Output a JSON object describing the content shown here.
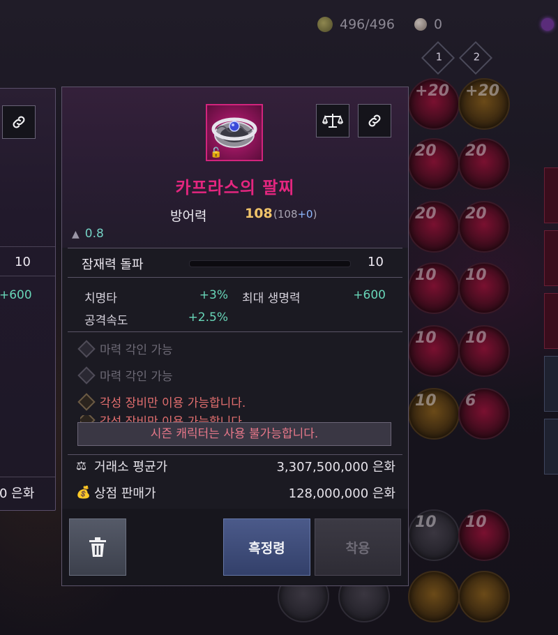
{
  "topbar": {
    "energy": "496/496",
    "pearls": "0",
    "presets": [
      "1",
      "2"
    ]
  },
  "left_tooltip": {
    "breakthrough_value": "10",
    "hp_value": "+600",
    "shop_price_partial": "0 은화"
  },
  "item": {
    "name": "카프라스의 팔찌",
    "defense_label": "방어력",
    "defense_value": "108",
    "defense_base_open": "(108",
    "defense_bonus": "+0",
    "defense_base_close": ")",
    "weight": "0.8",
    "locked": true,
    "rarity_color": "#d2247d"
  },
  "breakthrough": {
    "label": "잠재력 돌파",
    "value": "10"
  },
  "stats": [
    {
      "name": "치명타",
      "value": "+3%"
    },
    {
      "name": "최대 생명력",
      "value": "+600"
    },
    {
      "name": "공격속도",
      "value": "+2.5%"
    }
  ],
  "engravings": [
    {
      "text": "마력 각인 가능",
      "state": "disabled"
    },
    {
      "text": "마력 각인 가능",
      "state": "disabled"
    },
    {
      "text": "각성 장비만 이용 가능합니다.",
      "state": "warning"
    },
    {
      "text": "각성 장비만 이용 가능합니다.",
      "state": "warning-clipped"
    }
  ],
  "season_warning": "시즌 캐릭터는 사용 불가능합니다.",
  "prices": {
    "market_label": "거래소 평균가",
    "market_value": "3,307,500,000 은화",
    "shop_label": "상점 판매가",
    "shop_value": "128,000,000 은화"
  },
  "buttons": {
    "extract": "흑정령",
    "equip": "착용"
  },
  "slots": {
    "levels": [
      "+20",
      "+20",
      "20",
      "20",
      "20",
      "20",
      "10",
      "10",
      "10",
      "10",
      "10",
      "6",
      "10",
      "10"
    ]
  },
  "colors": {
    "item_name": "#e4267f",
    "defense": "#f0c36a",
    "stat_value": "#68d6b8",
    "warning": "#e8788a"
  }
}
